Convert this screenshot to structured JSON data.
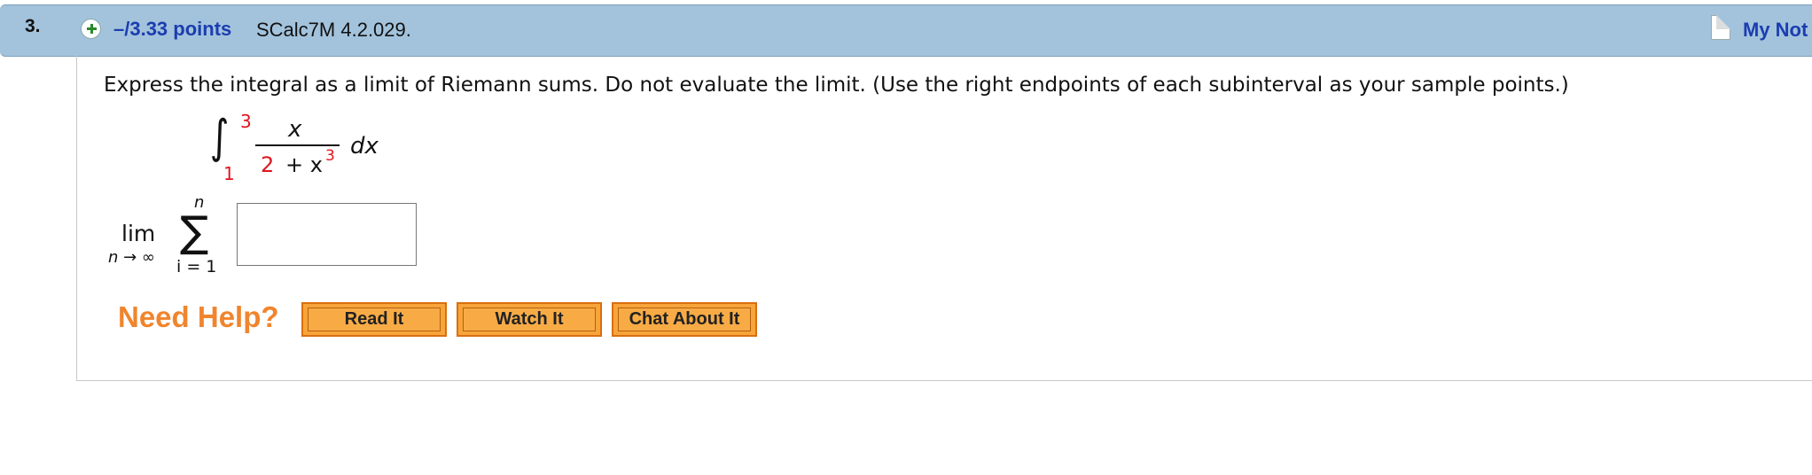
{
  "question": {
    "number": "3.",
    "points": "–/3.33 points",
    "source": "SCalc7M 4.2.029.",
    "my_notes": "My Not"
  },
  "prompt": "Express the integral as a limit of Riemann sums. Do not evaluate the limit. (Use the right endpoints of each subinterval as your sample points.)",
  "integral": {
    "sign": "∫",
    "upper": "3",
    "lower": "1",
    "numerator": "x",
    "denominator_const": "2",
    "denominator_rest": "+ x",
    "denominator_exp": "3",
    "differential": "dx"
  },
  "limit": {
    "lim": "lim",
    "subscript": "n → ∞",
    "sigma": "∑",
    "sigma_upper": "n",
    "sigma_lower": "i = 1",
    "answer_value": ""
  },
  "help": {
    "title": "Need Help?",
    "buttons": [
      "Read It",
      "Watch It",
      "Chat About It"
    ]
  },
  "colors": {
    "header_bg": "#a3c3dc",
    "link_blue": "#1b3db0",
    "highlight_red": "#e0141e",
    "help_orange": "#f0852d",
    "button_orange": "#f7a53a"
  }
}
